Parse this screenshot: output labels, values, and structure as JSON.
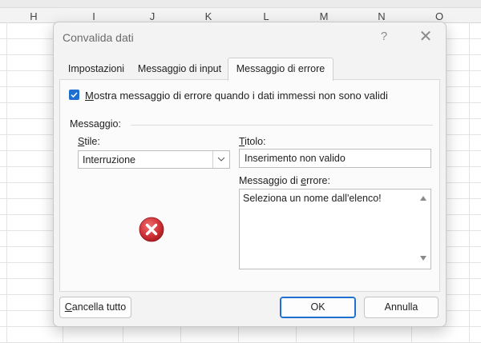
{
  "sheet": {
    "columns": [
      "H",
      "I",
      "J",
      "K",
      "L",
      "M",
      "N",
      "O"
    ]
  },
  "dialog": {
    "title": "Convalida dati",
    "help": "?",
    "close": "✕",
    "tabs": [
      {
        "label": "Impostazioni",
        "active": false
      },
      {
        "label": "Messaggio di input",
        "active": false
      },
      {
        "label": "Messaggio di errore",
        "active": true
      }
    ],
    "checkbox": {
      "checked": true,
      "label_first": "M",
      "label_rest": "ostra messaggio di errore quando i dati immessi non sono validi"
    },
    "group_label": "Messaggio:",
    "style_label_first": "S",
    "style_label_rest": "tile:",
    "style_value": "Interruzione",
    "title_label_first": "T",
    "title_label_rest": "itolo:",
    "title_value": "Inserimento non valido",
    "msg_label_pre": "Messaggio di ",
    "msg_label_u": "e",
    "msg_label_post": "rrore:",
    "msg_value": "Seleziona un nome dall'elenco!",
    "buttons": {
      "clear_first": "C",
      "clear_rest": "ancella tutto",
      "ok": "OK",
      "cancel": "Annulla"
    }
  },
  "colors": {
    "accent": "#1f6fd1",
    "error_icon": "#d13438"
  }
}
